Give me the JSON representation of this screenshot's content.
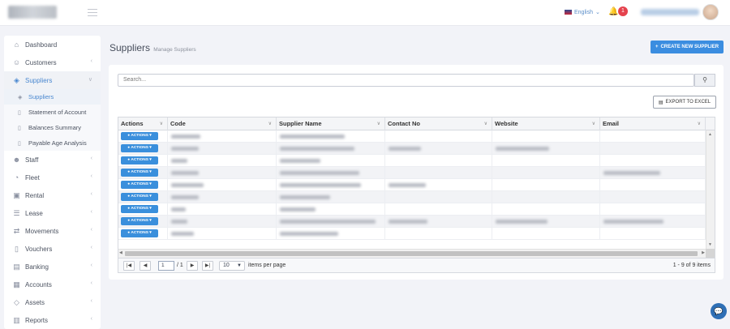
{
  "header": {
    "language": "English",
    "notification_count": "1"
  },
  "sidebar": {
    "items": [
      {
        "label": "Dashboard",
        "icon": "home-icon",
        "chevron": false
      },
      {
        "label": "Customers",
        "icon": "users-icon",
        "chevron": true
      },
      {
        "label": "Suppliers",
        "icon": "layers-icon",
        "chevron": true,
        "active": true
      },
      {
        "label": "Staff",
        "icon": "user-group-icon",
        "chevron": true
      },
      {
        "label": "Fleet",
        "icon": "gauge-icon",
        "chevron": true
      },
      {
        "label": "Rental",
        "icon": "car-icon",
        "chevron": true
      },
      {
        "label": "Lease",
        "icon": "stack-icon",
        "chevron": true
      },
      {
        "label": "Movements",
        "icon": "movement-icon",
        "chevron": true
      },
      {
        "label": "Vouchers",
        "icon": "voucher-icon",
        "chevron": true
      },
      {
        "label": "Banking",
        "icon": "bank-icon",
        "chevron": true
      },
      {
        "label": "Accounts",
        "icon": "accounts-icon",
        "chevron": true
      },
      {
        "label": "Assets",
        "icon": "diamond-icon",
        "chevron": true
      },
      {
        "label": "Reports",
        "icon": "report-icon",
        "chevron": true
      }
    ],
    "suppliers_sub": [
      {
        "label": "Suppliers",
        "active": true
      },
      {
        "label": "Statement of Account"
      },
      {
        "label": "Balances Summary"
      },
      {
        "label": "Payable Age Analysis"
      }
    ]
  },
  "main": {
    "title": "Suppliers",
    "subtitle": "Manage Suppliers",
    "create_button": "CREATE NEW SUPPLIER",
    "search_placeholder": "Search...",
    "export_button": "EXPORT TO EXCEL"
  },
  "grid": {
    "columns": [
      "Actions",
      "Code",
      "Supplier Name",
      "Contact No",
      "Website",
      "Email"
    ],
    "action_label": "ACTIONS",
    "rows": [
      {
        "code": 36,
        "name": 80,
        "contact": 0,
        "website": 0,
        "email": 0
      },
      {
        "code": 34,
        "name": 92,
        "contact": 40,
        "website": 66,
        "email": 0
      },
      {
        "code": 20,
        "name": 50,
        "contact": 0,
        "website": 0,
        "email": 0
      },
      {
        "code": 34,
        "name": 98,
        "contact": 0,
        "website": 0,
        "email": 70
      },
      {
        "code": 40,
        "name": 100,
        "contact": 46,
        "website": 0,
        "email": 0
      },
      {
        "code": 34,
        "name": 62,
        "contact": 0,
        "website": 0,
        "email": 0
      },
      {
        "code": 18,
        "name": 44,
        "contact": 0,
        "website": 0,
        "email": 0
      },
      {
        "code": 20,
        "name": 118,
        "contact": 48,
        "website": 64,
        "email": 74
      },
      {
        "code": 28,
        "name": 72,
        "contact": 0,
        "website": 0,
        "email": 0
      }
    ]
  },
  "pager": {
    "current_page": "1",
    "of_pages": "/ 1",
    "page_size": "10",
    "items_per_page": "items per page",
    "info": "1 - 9 of 9 items"
  }
}
